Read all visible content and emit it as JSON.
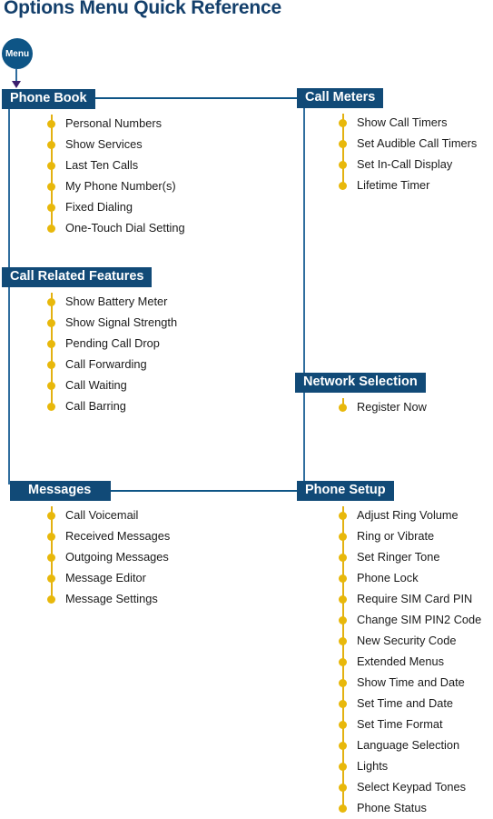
{
  "title": "Options Menu Quick Reference",
  "colors": {
    "header_box": "#114A77",
    "title_text": "#133F6B",
    "trunk_line": "#2F6D9E",
    "bullet": "#E8B80B",
    "bullet_spine": "#E3B111",
    "arrow_head": "#3B1E6E"
  },
  "root": {
    "label": "Menu"
  },
  "sections": [
    {
      "id": "phone-book",
      "title": "Phone Book",
      "column": "left",
      "items": [
        "Personal Numbers",
        "Show Services",
        "Last Ten Calls",
        "My Phone Number(s)",
        "Fixed Dialing",
        "One-Touch Dial Setting"
      ]
    },
    {
      "id": "call-related-features",
      "title": "Call Related Features",
      "column": "left",
      "items": [
        "Show Battery Meter",
        "Show Signal Strength",
        "Pending Call Drop",
        "Call Forwarding",
        "Call Waiting",
        "Call Barring"
      ]
    },
    {
      "id": "messages",
      "title": "Messages",
      "column": "left",
      "items": [
        "Call Voicemail",
        "Received Messages",
        "Outgoing Messages",
        "Message Editor",
        "Message Settings"
      ]
    },
    {
      "id": "call-meters",
      "title": "Call Meters",
      "column": "right",
      "items": [
        "Show Call Timers",
        "Set Audible Call Timers",
        "Set In-Call Display",
        "Lifetime Timer"
      ]
    },
    {
      "id": "network-selection",
      "title": "Network Selection",
      "column": "right",
      "items": [
        "Register Now"
      ]
    },
    {
      "id": "phone-setup",
      "title": "Phone Setup",
      "column": "right",
      "items": [
        "Adjust Ring Volume",
        "Ring or Vibrate",
        "Set Ringer Tone",
        "Phone Lock",
        "Require SIM Card PIN",
        "Change SIM PIN2 Code",
        "New Security Code",
        "Extended Menus",
        "Show Time and Date",
        "Set Time and Date",
        "Set Time Format",
        "Language Selection",
        "Lights",
        "Select Keypad Tones",
        "Phone Status"
      ]
    }
  ]
}
